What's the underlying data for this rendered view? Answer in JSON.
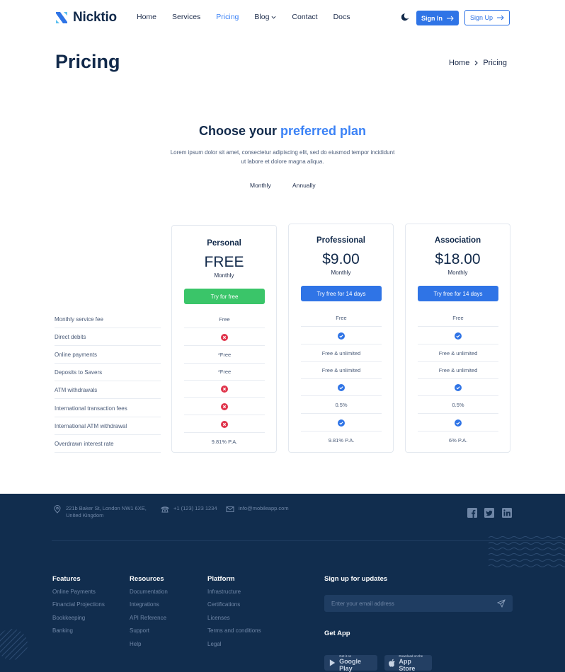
{
  "brand": {
    "name": "Nicktio"
  },
  "nav": {
    "items": [
      {
        "label": "Home",
        "active": false
      },
      {
        "label": "Services",
        "active": false
      },
      {
        "label": "Pricing",
        "active": true
      },
      {
        "label": "Blog",
        "active": false
      },
      {
        "label": "Contact",
        "active": false
      },
      {
        "label": "Docs",
        "active": false
      }
    ],
    "signin_label": "Sign In",
    "signup_label": "Sign Up"
  },
  "page": {
    "title": "Pricing",
    "breadcrumb": [
      "Home",
      "Pricing"
    ]
  },
  "section": {
    "title_prefix": "Choose your ",
    "title_highlight": "preferred plan",
    "subtitle": "Lorem ipsum dolor sit amet, consectetur adipiscing elit, sed do eiusmod tempor incididunt ut labore et dolore magna aliqua.",
    "toggle": [
      "Monthly",
      "Annually"
    ]
  },
  "features": [
    "Monthly service fee",
    "Direct debits",
    "Online payments",
    "Deposits to Savers",
    "ATM withdrawals",
    "International transaction fees",
    "International ATM withdrawal",
    "Overdrawn interest rate"
  ],
  "plans": [
    {
      "name": "Personal",
      "price": "FREE",
      "period": "Monthly",
      "button": "Try for free",
      "button_color": "#3ac569",
      "values": [
        "Free",
        "x",
        "*Free",
        "*Free",
        "x",
        "x",
        "x",
        "9.81% P.A."
      ]
    },
    {
      "name": "Professional",
      "price": "$9.00",
      "period": "Monthly",
      "button": "Try free for 14 days",
      "button_color": "#2f74e6",
      "values": [
        "Free",
        "check",
        "Free & unlimited",
        "Free & unlimited",
        "check",
        "0.5%",
        "check",
        "9.81% P.A."
      ]
    },
    {
      "name": "Association",
      "price": "$18.00",
      "period": "Monthly",
      "button": "Try free for 14 days",
      "button_color": "#2f74e6",
      "values": [
        "Free",
        "check",
        "Free & unlimited",
        "Free & unlimited",
        "check",
        "0.5%",
        "check",
        "6% P.A."
      ]
    }
  ],
  "footer": {
    "address_line1": "221b Baker St, London NW1 6XE,",
    "address_line2": "United Kingdom",
    "phone": "+1 (123) 123 1234",
    "email": "info@mobileapp.com",
    "social": [
      "facebook-icon",
      "twitter-icon",
      "linkedin-icon"
    ],
    "columns": [
      {
        "title": "Features",
        "links": [
          "Online Payments",
          "Financial Projections",
          "Bookkeeping",
          "Banking"
        ]
      },
      {
        "title": "Resources",
        "links": [
          "Documentation",
          "Integrations",
          "API Reference",
          "Support",
          "Help"
        ]
      },
      {
        "title": "Platform",
        "links": [
          "Infrastructure",
          "Certifications",
          "Licenses",
          "Terms and conditions",
          "Legal"
        ]
      }
    ],
    "signup_title": "Sign up for updates",
    "email_placeholder": "Enter your email address",
    "get_app_title": "Get App",
    "google_play_small": "Get it on",
    "google_play_big": "Google Play",
    "app_store_small": "Download on the",
    "app_store_big": "App Store"
  },
  "colors": {
    "accent": "#3b82f6",
    "primary_button": "#2f74e6",
    "free_button": "#3ac569",
    "cross": "#e0344b",
    "footer_bg": "#112d4e"
  }
}
